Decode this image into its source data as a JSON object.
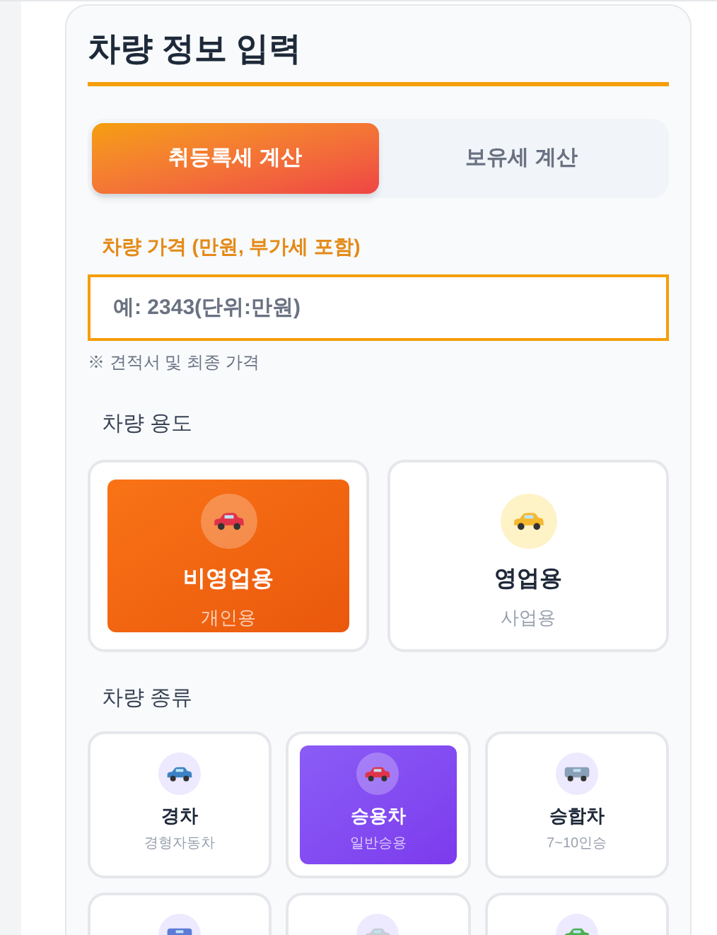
{
  "title": "차량 정보 입력",
  "tabs": [
    {
      "label": "취등록세 계산",
      "selected": true
    },
    {
      "label": "보유세 계산",
      "selected": false
    }
  ],
  "price_field": {
    "label": "차량 가격 (만원, 부가세 포함)",
    "placeholder": "예: 2343(단위:만원)",
    "note": "※ 견적서 및 최종 가격"
  },
  "usage": {
    "heading": "차량 용도",
    "options": [
      {
        "label": "비영업용",
        "sub": "개인용",
        "selected": true
      },
      {
        "label": "영업용",
        "sub": "사업용",
        "selected": false
      }
    ]
  },
  "vehicle_type": {
    "heading": "차량 종류",
    "options": [
      {
        "label": "경차",
        "sub": "경형자동차",
        "selected": false
      },
      {
        "label": "승용차",
        "sub": "일반승용",
        "selected": true
      },
      {
        "label": "승합차",
        "sub": "7~10인승",
        "selected": false
      },
      {
        "selected": false
      },
      {
        "selected": false
      },
      {
        "selected": false
      }
    ]
  }
}
